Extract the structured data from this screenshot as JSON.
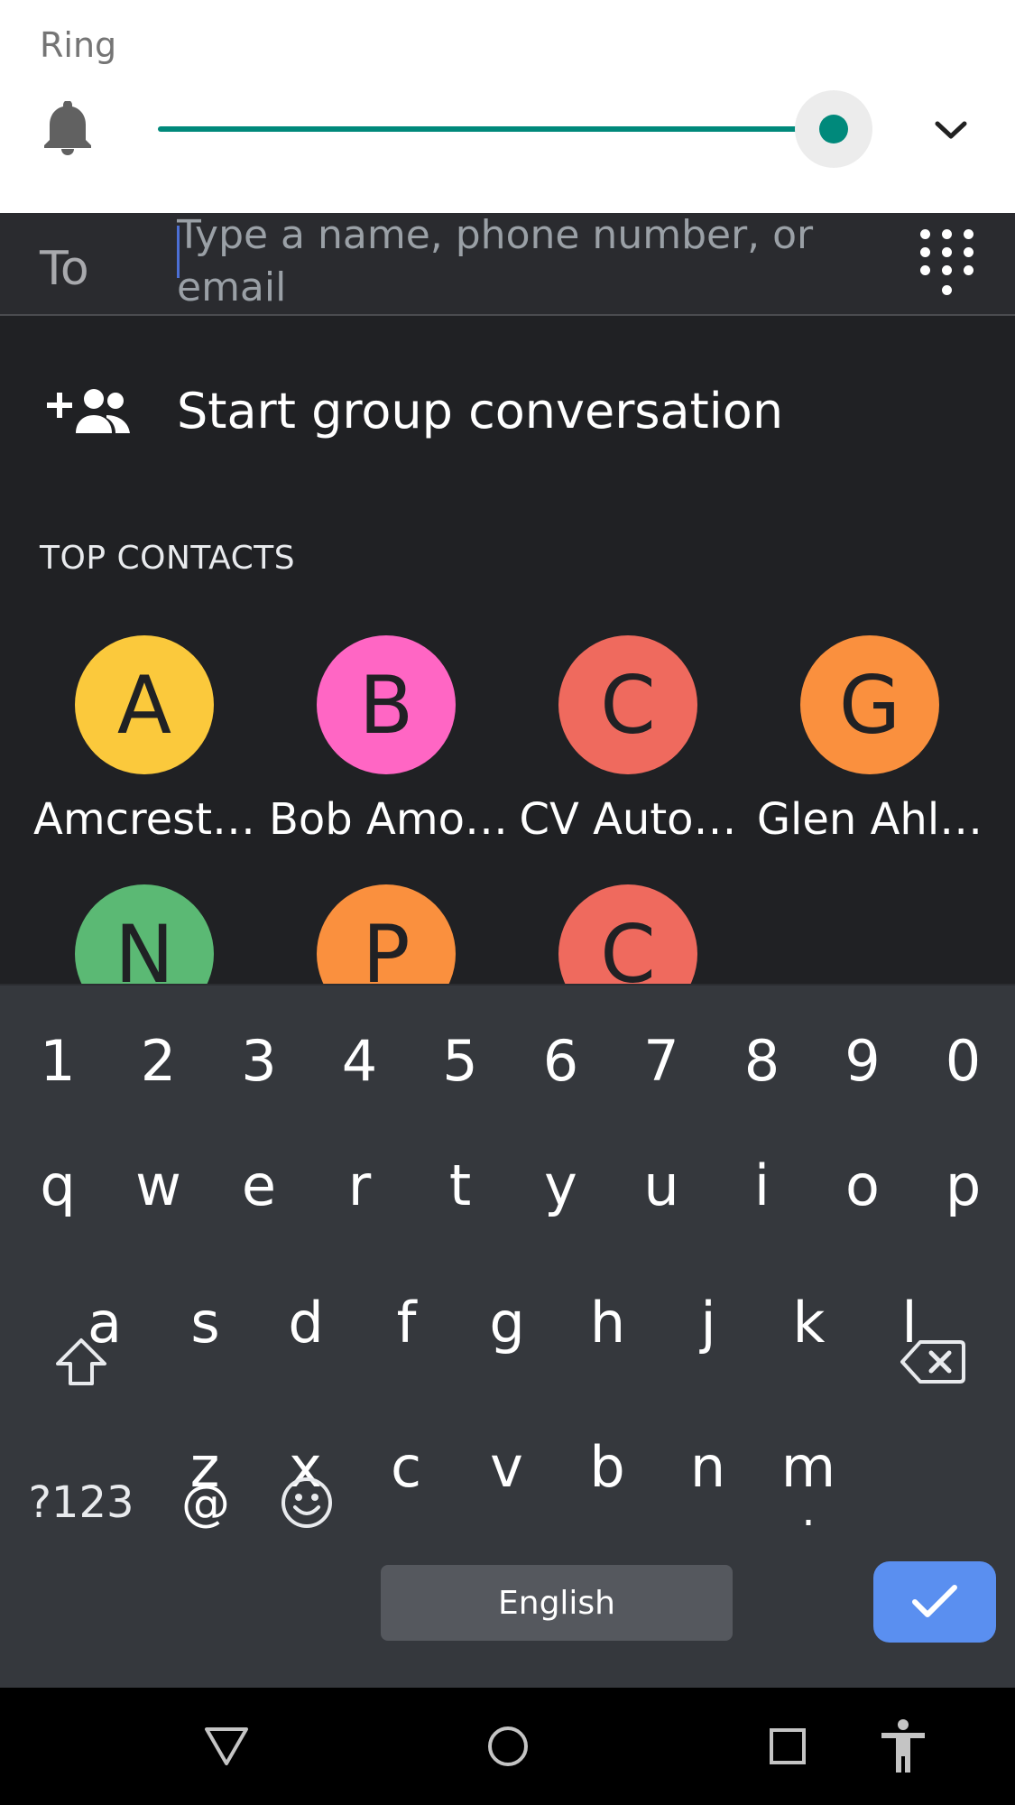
{
  "volume_panel": {
    "label": "Ring",
    "level": 1.0,
    "accent_color": "#00897b",
    "icons": {
      "stream": "bell-icon",
      "expand": "chevron-down-icon"
    }
  },
  "compose": {
    "to_label": "To",
    "recipient_placeholder": "Type a name, phone number, or email",
    "recipient_value": "",
    "dialpad_icon": "dialpad-icon",
    "group_action": {
      "icon": "add-group-icon",
      "label": "Start group conversation"
    },
    "top_contacts_heading": "TOP CONTACTS",
    "contacts": [
      {
        "initial": "A",
        "name": "Amcrest…",
        "color": "#fbc93c"
      },
      {
        "initial": "B",
        "name": "Bob Amo…",
        "color": "#ff66c4"
      },
      {
        "initial": "C",
        "name": "CV Auto…",
        "color": "#ef6a5e"
      },
      {
        "initial": "G",
        "name": "Glen Ahl…",
        "color": "#fa903e"
      },
      {
        "initial": "N",
        "name": "",
        "color": "#5bb974"
      },
      {
        "initial": "P",
        "name": "",
        "color": "#fa903e"
      },
      {
        "initial": "C",
        "name": "",
        "color": "#ef6a5e"
      }
    ]
  },
  "keyboard": {
    "number_row": [
      "1",
      "2",
      "3",
      "4",
      "5",
      "6",
      "7",
      "8",
      "9",
      "0"
    ],
    "row_q": [
      "q",
      "w",
      "e",
      "r",
      "t",
      "y",
      "u",
      "i",
      "o",
      "p"
    ],
    "row_a": [
      "a",
      "s",
      "d",
      "f",
      "g",
      "h",
      "j",
      "k",
      "l"
    ],
    "row_z": [
      "z",
      "x",
      "c",
      "v",
      "b",
      "n",
      "m"
    ],
    "symbols_label": "?123",
    "at_label": "@",
    "emoji_icon": "emoji-icon",
    "space_label": "English",
    "period_label": ".",
    "shift_icon": "shift-icon",
    "backspace_icon": "backspace-icon",
    "done_icon": "checkmark-icon",
    "done_color": "#5a8ff0"
  },
  "nav_bar": {
    "icons": [
      "back-icon",
      "home-icon",
      "recents-icon",
      "accessibility-icon"
    ]
  }
}
